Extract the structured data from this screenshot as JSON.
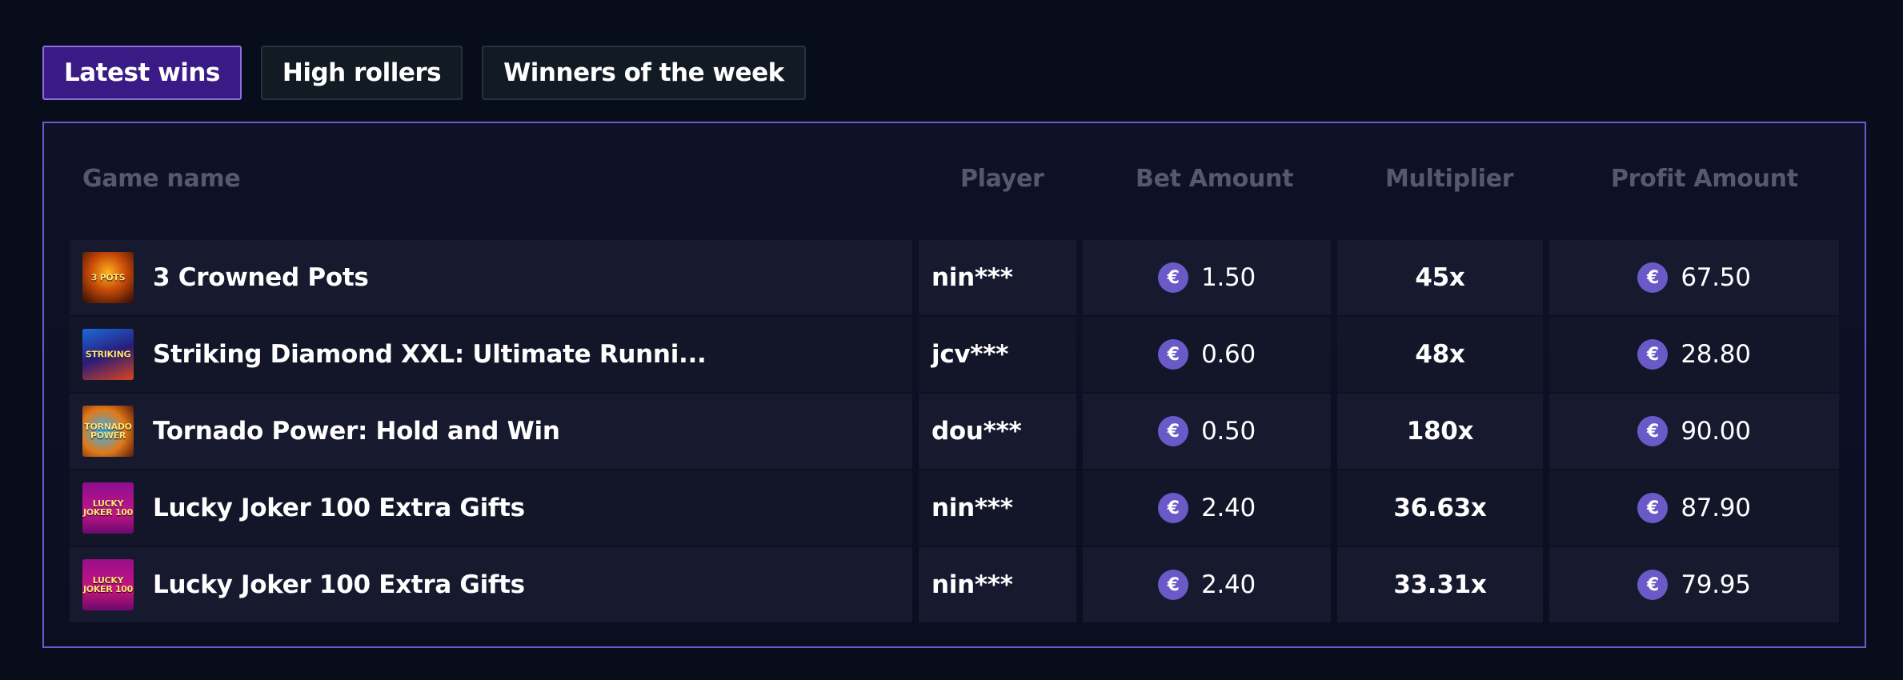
{
  "tabs": [
    {
      "label": "Latest wins",
      "active": true
    },
    {
      "label": "High rollers",
      "active": false
    },
    {
      "label": "Winners of the week",
      "active": false
    }
  ],
  "table": {
    "headers": {
      "game": "Game name",
      "player": "Player",
      "bet": "Bet Amount",
      "multiplier": "Multiplier",
      "profit": "Profit Amount"
    },
    "rows": [
      {
        "game": "3 Crowned Pots",
        "thumb_text": "3 POTS",
        "player": "nin***",
        "bet": "1.50",
        "multiplier": "45x",
        "profit": "67.50"
      },
      {
        "game": "Striking Diamond XXL: Ultimate Runni...",
        "thumb_text": "STRIKING",
        "player": "jcv***",
        "bet": "0.60",
        "multiplier": "48x",
        "profit": "28.80"
      },
      {
        "game": "Tornado Power: Hold and Win",
        "thumb_text": "TORNADO POWER",
        "player": "dou***",
        "bet": "0.50",
        "multiplier": "180x",
        "profit": "90.00"
      },
      {
        "game": "Lucky Joker 100 Extra Gifts",
        "thumb_text": "LUCKY JOKER 100",
        "player": "nin***",
        "bet": "2.40",
        "multiplier": "36.63x",
        "profit": "87.90"
      },
      {
        "game": "Lucky Joker 100 Extra Gifts",
        "thumb_text": "LUCKY JOKER 100",
        "player": "nin***",
        "bet": "2.40",
        "multiplier": "33.31x",
        "profit": "79.95"
      }
    ],
    "currency_symbol": "€"
  },
  "colors": {
    "background": "#080d1b",
    "accent": "#6a5acd",
    "active_tab": "#3a1a85",
    "coin": "#6a5ac8"
  },
  "icons": {
    "currency": "euro-coin-icon"
  }
}
